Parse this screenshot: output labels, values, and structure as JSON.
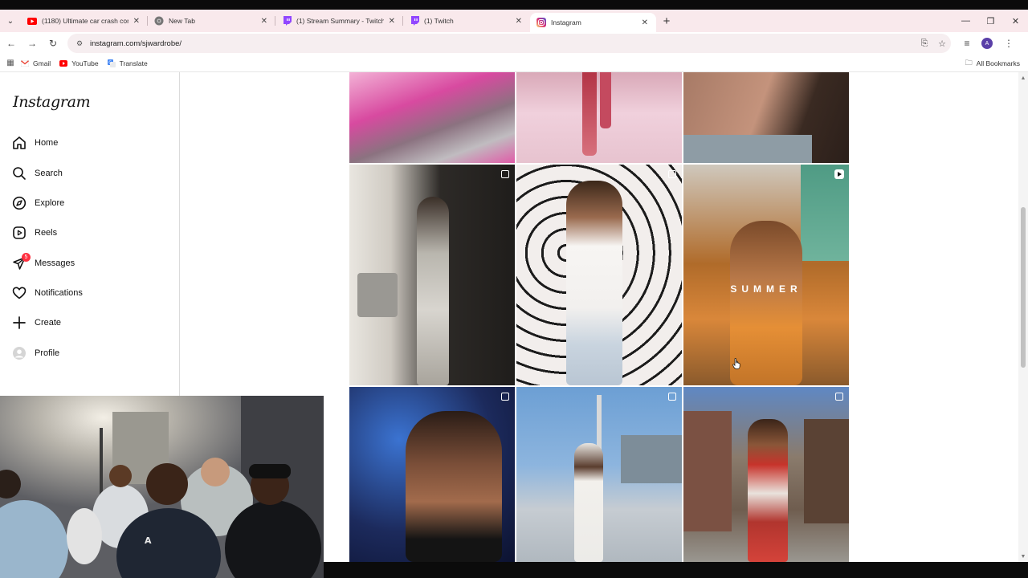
{
  "browser": {
    "tabs": [
      {
        "title": "(1180) Ultimate car crash comp",
        "favicon": "youtube-icon",
        "color": "#ff0000"
      },
      {
        "title": "New Tab",
        "favicon": "chrome-icon",
        "color": "#666666"
      },
      {
        "title": "(1) Stream Summary - Twitch",
        "favicon": "twitch-icon",
        "color": "#9146ff"
      },
      {
        "title": "(1) Twitch",
        "favicon": "twitch-icon",
        "color": "#9146ff"
      },
      {
        "title": "Instagram",
        "favicon": "instagram-icon",
        "color": "#e1306c",
        "active": true
      }
    ],
    "url": "instagram.com/sjwardrobe/",
    "profile_initial": "A",
    "bookmarks": [
      {
        "label": "Gmail",
        "icon": "gmail-icon"
      },
      {
        "label": "YouTube",
        "icon": "youtube-icon"
      },
      {
        "label": "Translate",
        "icon": "translate-icon"
      }
    ],
    "all_bookmarks_label": "All Bookmarks"
  },
  "instagram": {
    "logo": "Instagram",
    "nav": [
      {
        "label": "Home",
        "icon": "home-icon"
      },
      {
        "label": "Search",
        "icon": "search-icon"
      },
      {
        "label": "Explore",
        "icon": "explore-icon"
      },
      {
        "label": "Reels",
        "icon": "reels-icon"
      },
      {
        "label": "Messages",
        "icon": "messages-icon",
        "badge": "5"
      },
      {
        "label": "Notifications",
        "icon": "heart-icon"
      },
      {
        "label": "Create",
        "icon": "plus-icon"
      },
      {
        "label": "Profile",
        "icon": "profile-avatar"
      }
    ],
    "posts": [
      {
        "row": 0,
        "col": 0,
        "type": "image",
        "colors": [
          "#d84aa0",
          "#f4b6d9",
          "#6d5a68"
        ]
      },
      {
        "row": 0,
        "col": 1,
        "type": "image",
        "colors": [
          "#e9b8c9",
          "#c44a5f",
          "#f3d2dc"
        ]
      },
      {
        "row": 0,
        "col": 2,
        "type": "image",
        "colors": [
          "#3b2a24",
          "#b8836a",
          "#8c9aa3"
        ]
      },
      {
        "row": 1,
        "col": 0,
        "type": "carousel",
        "colors": [
          "#2a2826",
          "#b9b6ae",
          "#5b534b"
        ]
      },
      {
        "row": 1,
        "col": 1,
        "type": "carousel",
        "colors": [
          "#f1ecea",
          "#222222",
          "#9a6a4e"
        ]
      },
      {
        "row": 1,
        "col": 2,
        "type": "reel",
        "overlay_text": "SUMMER",
        "colors": [
          "#b06b2a",
          "#e08a35",
          "#5c8f7f"
        ]
      },
      {
        "row": 2,
        "col": 0,
        "type": "carousel",
        "colors": [
          "#1c2a5c",
          "#2f5bb0",
          "#6b4a3a"
        ]
      },
      {
        "row": 2,
        "col": 1,
        "type": "carousel",
        "colors": [
          "#5b8fc9",
          "#eef1f3",
          "#a8b6c0"
        ]
      },
      {
        "row": 2,
        "col": 2,
        "type": "carousel",
        "colors": [
          "#5f88c4",
          "#b1352e",
          "#7c6a5c"
        ]
      }
    ]
  },
  "colors": {
    "tabstrip_bg": "#f9e9ec",
    "omnibox_bg": "#f6eef0",
    "badge_red": "#ff3040",
    "border": "#dbdbdb"
  }
}
